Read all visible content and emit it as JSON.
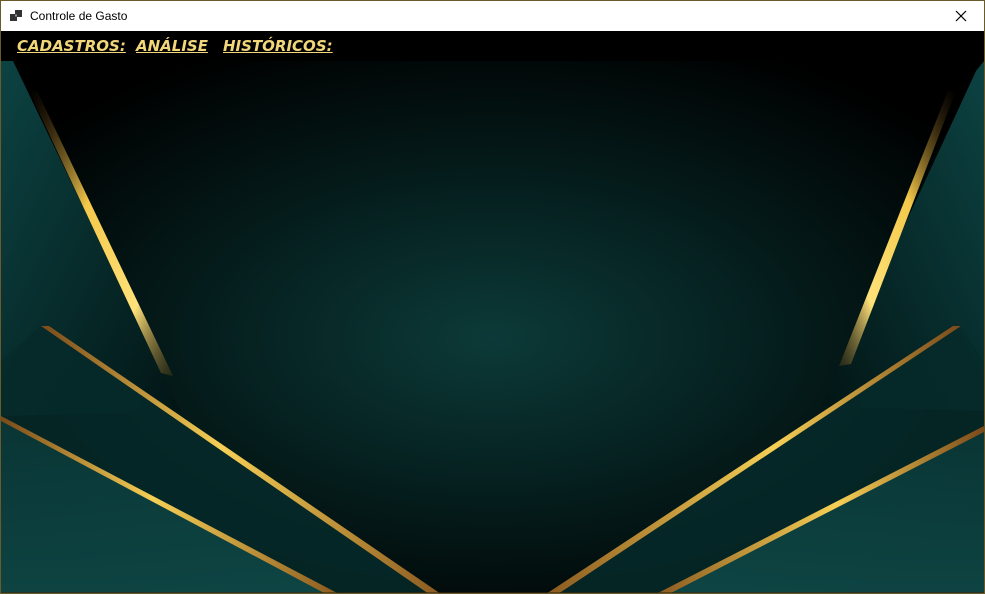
{
  "window": {
    "title": "Controle de Gasto",
    "icon": "app-window-icon",
    "close_icon": "close-icon"
  },
  "menu": {
    "items": [
      {
        "label": "CADASTROS:"
      },
      {
        "label": "ANÁLISE"
      },
      {
        "label": "HISTÓRICOS:"
      }
    ],
    "color": "#f2d77a"
  },
  "theme": {
    "background": "#000000",
    "teal": "#0f4a49",
    "gold": "#f0c24a"
  }
}
